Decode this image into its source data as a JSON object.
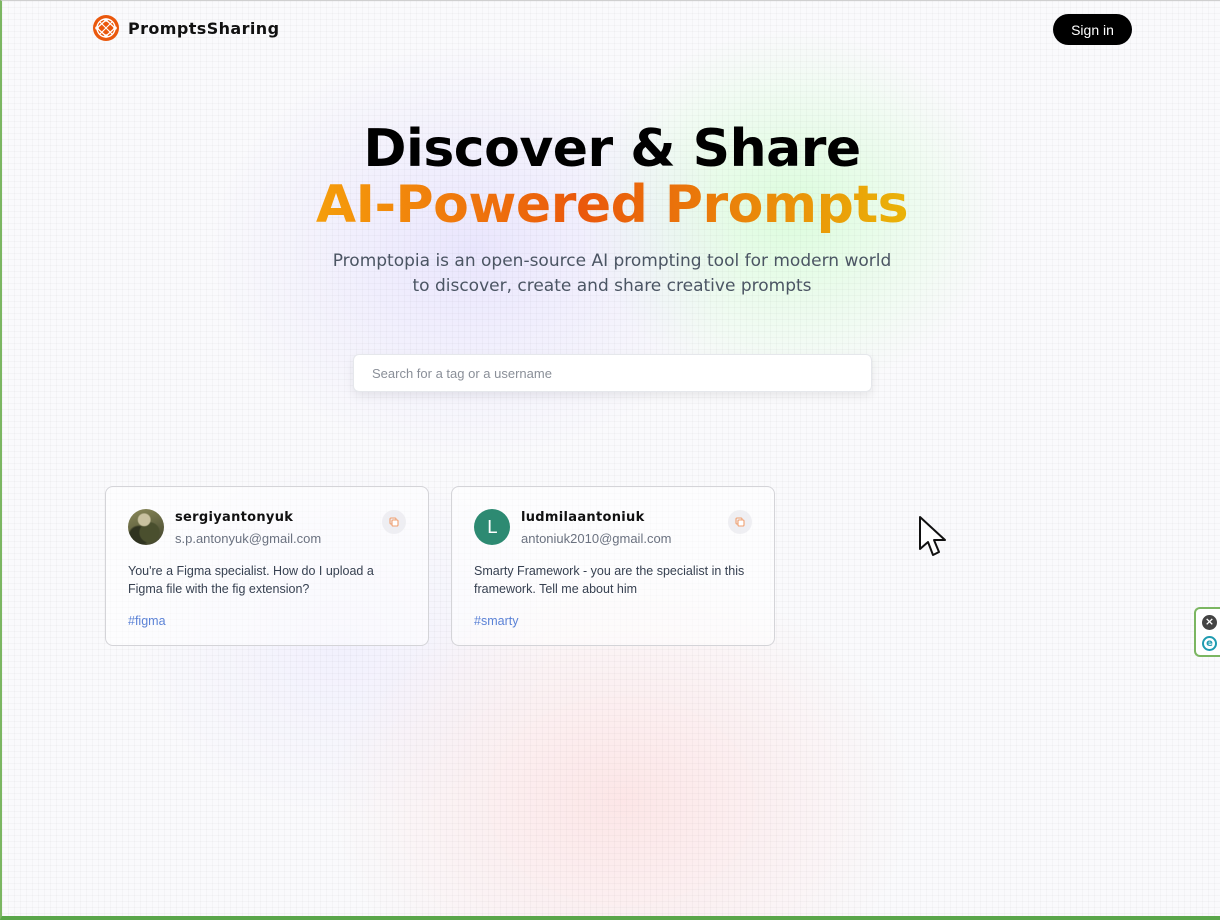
{
  "nav": {
    "brand": "PromptsSharing",
    "signin_label": "Sign in",
    "logo_icon": "globe-logo-icon"
  },
  "hero": {
    "title_line1": "Discover & Share",
    "title_line2": "AI-Powered Prompts",
    "description": "Promptopia is an open-source AI prompting tool for modern world to discover, create and share creative prompts"
  },
  "search": {
    "placeholder": "Search for a tag or a username",
    "value": ""
  },
  "prompts": [
    {
      "username": "sergiyantonyuk",
      "email": "s.p.antonyuk@gmail.com",
      "avatar": "photo",
      "prompt": "You're a Figma specialist. How do I upload a Figma file with the fig extension?",
      "tag": "#figma"
    },
    {
      "username": "ludmilaantoniuk",
      "email": "antoniuk2010@gmail.com",
      "avatar_letter": "L",
      "prompt": "Smarty Framework - you are the specialist in this framework. Tell me about him",
      "tag": "#smarty"
    }
  ],
  "colors": {
    "accent_start": "#f59e0b",
    "accent_mid": "#ea580c",
    "accent_end": "#eab308",
    "tag_blue": "#5b82d6",
    "avatar_green": "#2d8a72"
  }
}
